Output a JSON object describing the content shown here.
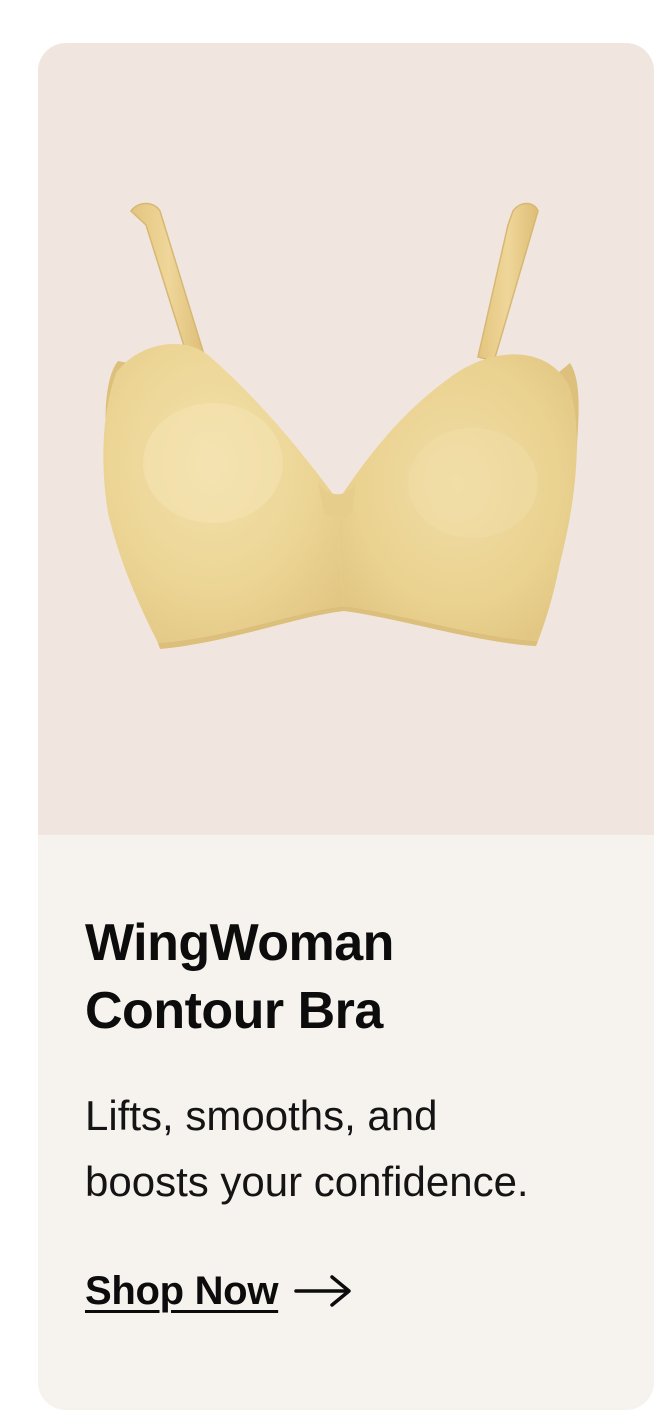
{
  "product": {
    "title_line1": "WingWoman",
    "title_line2": "Contour Bra",
    "description_line1": "Lifts, smooths, and",
    "description_line2": "boosts your confidence.",
    "cta_label": "Shop Now",
    "image_icon": "bra-product-image",
    "cta_icon": "arrow-right-icon"
  },
  "colors": {
    "hero_background": "#f0e6df",
    "info_background": "#f6f2ee",
    "product_color": "#edd69a",
    "text": "#0c0c0c"
  }
}
